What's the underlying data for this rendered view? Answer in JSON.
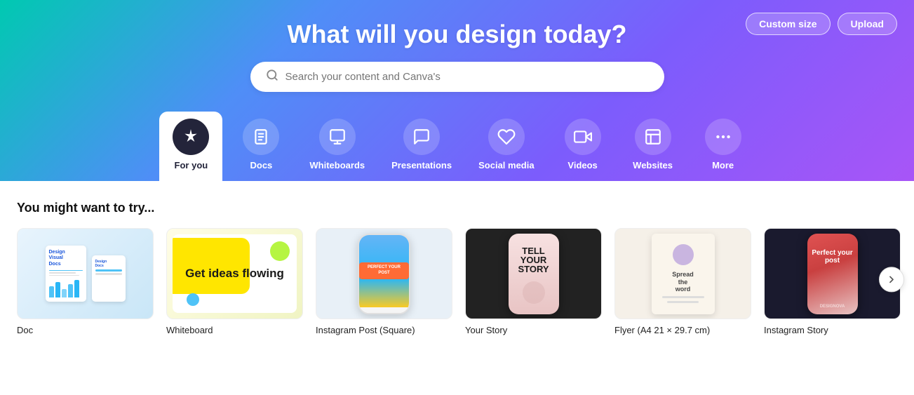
{
  "header": {
    "title": "What will you design today?",
    "search_placeholder": "Search your content and Canva's",
    "btn_custom": "Custom size",
    "btn_upload": "Upload"
  },
  "nav": {
    "items": [
      {
        "id": "for-you",
        "label": "For you",
        "icon": "✦",
        "active": true
      },
      {
        "id": "docs",
        "label": "Docs",
        "icon": "📄",
        "active": false
      },
      {
        "id": "whiteboards",
        "label": "Whiteboards",
        "icon": "🟩",
        "active": false
      },
      {
        "id": "presentations",
        "label": "Presentations",
        "icon": "💬",
        "active": false
      },
      {
        "id": "social-media",
        "label": "Social media",
        "icon": "♡",
        "active": false
      },
      {
        "id": "videos",
        "label": "Videos",
        "icon": "▶",
        "active": false
      },
      {
        "id": "websites",
        "label": "Websites",
        "icon": "⬛",
        "active": false
      },
      {
        "id": "more",
        "label": "More",
        "icon": "···",
        "active": false
      }
    ]
  },
  "section": {
    "title": "You might want to try..."
  },
  "cards": [
    {
      "id": "doc",
      "label": "Doc",
      "type": "doc"
    },
    {
      "id": "whiteboard",
      "label": "Whiteboard",
      "type": "whiteboard"
    },
    {
      "id": "ig-post",
      "label": "Instagram Post (Square)",
      "type": "igpost"
    },
    {
      "id": "your-story",
      "label": "Your Story",
      "type": "story"
    },
    {
      "id": "flyer",
      "label": "Flyer (A4 21 × 29.7 cm)",
      "type": "flyer"
    },
    {
      "id": "ig-story",
      "label": "Instagram Story",
      "type": "igstory"
    }
  ],
  "whiteboard_text": "Get ideas flowing",
  "story_text": "TELL YOUR STORY",
  "igstory_text": "Perfect your post",
  "phone_badge": "PERFECT YOUR POST"
}
